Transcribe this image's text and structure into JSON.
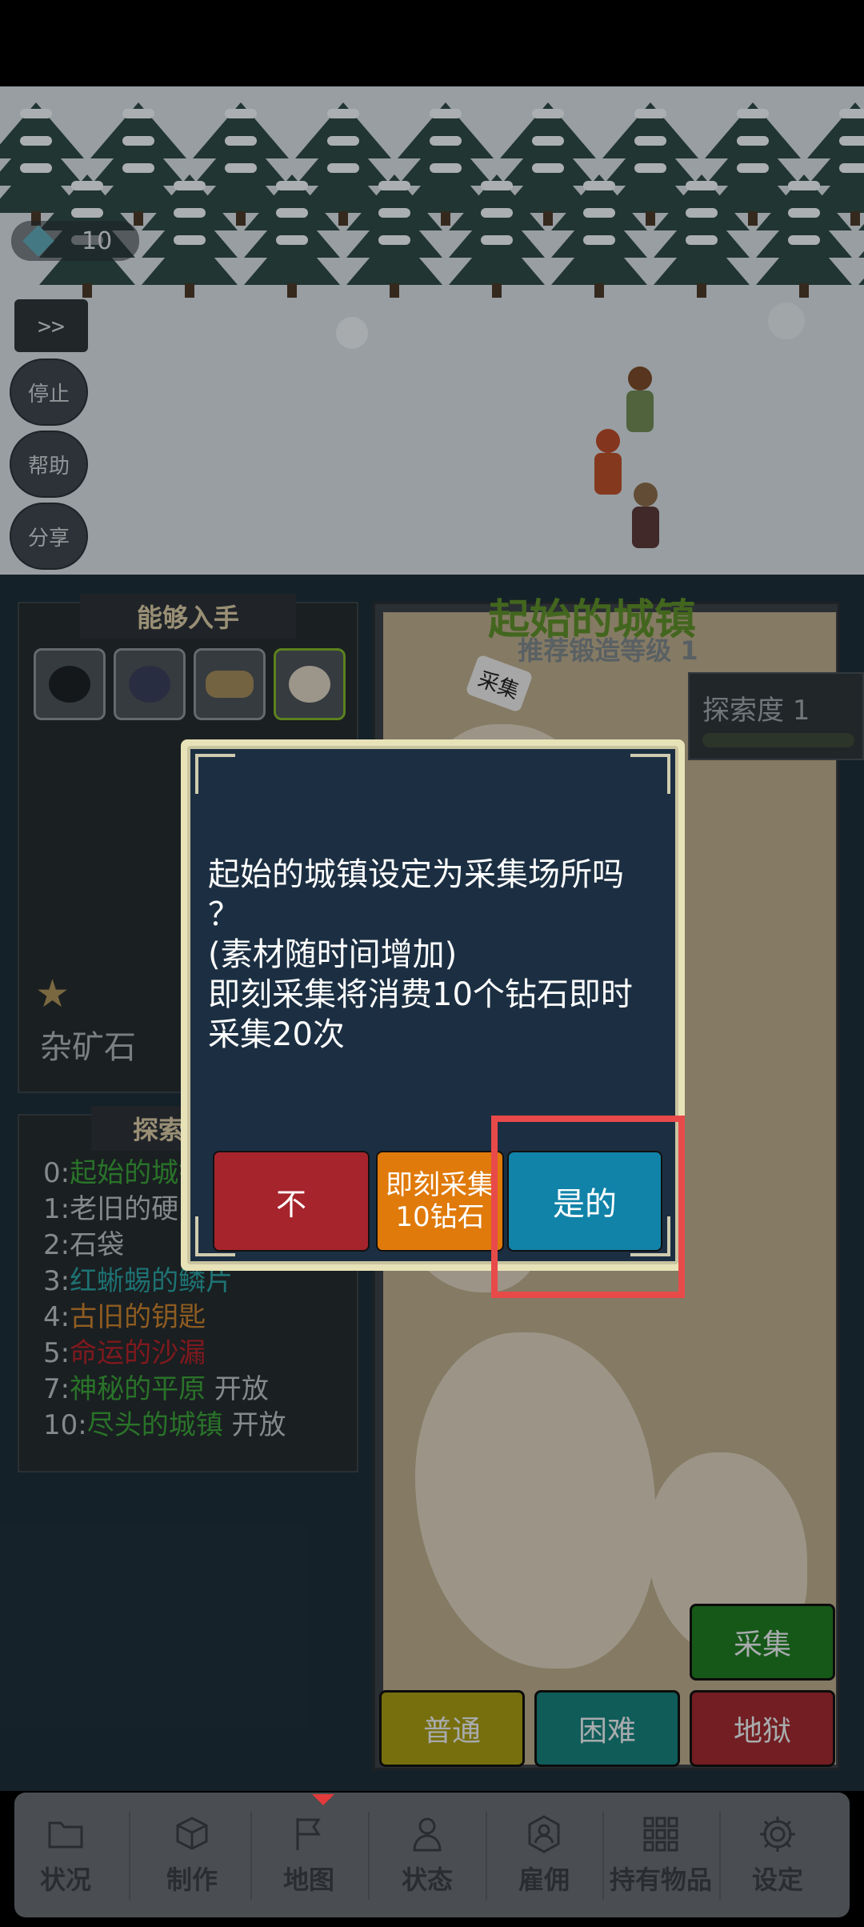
{
  "hud": {
    "gem_count": "10",
    "fast_forward": ">>",
    "buttons": [
      "停止",
      "帮助",
      "分享"
    ]
  },
  "obtain_panel": {
    "title": "能够入手",
    "items": [
      "coal-ore-icon",
      "iron-ore-icon",
      "wood-log-icon",
      "rock-ore-icon"
    ],
    "selected_index": 3,
    "selected_name": "杂矿石"
  },
  "explore_panel": {
    "title": "探索度",
    "entries": [
      {
        "num": "0:",
        "name": "起始的城镇",
        "color": "green",
        "suffix": ""
      },
      {
        "num": "1:",
        "name": "老旧的硬币",
        "color": "default",
        "suffix": ""
      },
      {
        "num": "2:",
        "name": "石袋",
        "color": "default",
        "suffix": ""
      },
      {
        "num": "3:",
        "name": "红蜥蜴的鳞片",
        "color": "teal",
        "suffix": ""
      },
      {
        "num": "4:",
        "name": "古旧的钥匙",
        "color": "orange",
        "suffix": ""
      },
      {
        "num": "5:",
        "name": "命运的沙漏",
        "color": "red",
        "suffix": ""
      },
      {
        "num": "7:",
        "name": "神秘的平原",
        "color": "green",
        "suffix": " 开放"
      },
      {
        "num": "10:",
        "name": "尽头的城镇",
        "color": "green",
        "suffix": " 开放"
      }
    ]
  },
  "map": {
    "title": "起始的城镇",
    "subtitle": "推荐锻造等级 1",
    "gather_tag": "采集",
    "explore_degree": "探索度 1",
    "gather_button": "采集",
    "difficulty": {
      "normal": "普通",
      "hard": "困难",
      "hell": "地狱"
    }
  },
  "dialog": {
    "message": "起始的城镇设定为采集场所吗\n？\n(素材随时间增加)\n即刻采集将消费10个钻石即时\n采集20次",
    "no": "不",
    "instant_line1": "即刻采集",
    "instant_line2": "10钻石",
    "yes": "是的"
  },
  "nav": {
    "items": [
      {
        "label": "状况",
        "icon": "folder-icon"
      },
      {
        "label": "制作",
        "icon": "box-icon"
      },
      {
        "label": "地图",
        "icon": "flag-icon"
      },
      {
        "label": "状态",
        "icon": "person-icon"
      },
      {
        "label": "雇佣",
        "icon": "hire-icon"
      },
      {
        "label": "持有物品",
        "icon": "grid-icon"
      },
      {
        "label": "设定",
        "icon": "gear-icon"
      }
    ],
    "active_index": 2
  },
  "colors": {
    "accent_red": "#e84a4a",
    "yes_button": "#1183a8",
    "no_button": "#a6242c",
    "instant_button": "#e07a0a"
  }
}
